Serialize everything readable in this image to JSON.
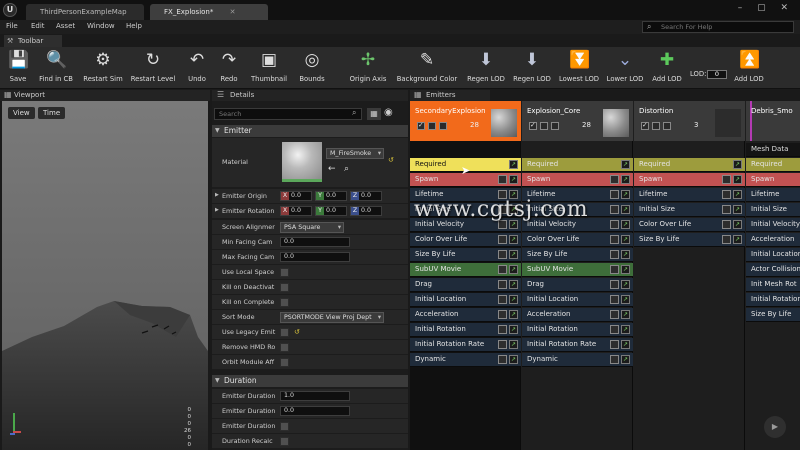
{
  "window": {
    "logo": "U",
    "tabs": [
      {
        "label": "ThirdPersonExampleMap"
      },
      {
        "label": "FX_Explosion*"
      }
    ],
    "controls_icons": [
      "minimize-icon",
      "maximize-icon",
      "close-icon"
    ],
    "controls_glyphs": "– ▢ ✕"
  },
  "menu": {
    "items": [
      "File",
      "Edit",
      "Asset",
      "Window",
      "Help"
    ],
    "search_placeholder": "Search For Help"
  },
  "toolbar": {
    "tab_label": "Toolbar",
    "buttons": [
      {
        "label": "Save",
        "icon": "save-icon",
        "glyph": "💾"
      },
      {
        "label": "Find in CB",
        "icon": "find-in-cb-icon",
        "glyph": "🔍"
      },
      {
        "label": "Restart Sim",
        "icon": "restart-sim-icon",
        "glyph": "⚙"
      },
      {
        "label": "Restart Level",
        "icon": "restart-level-icon",
        "glyph": "↻"
      },
      {
        "label": "Undo",
        "icon": "undo-icon",
        "glyph": "↶"
      },
      {
        "label": "Redo",
        "icon": "redo-icon",
        "glyph": "↷"
      },
      {
        "label": "Thumbnail",
        "icon": "thumbnail-icon",
        "glyph": "▣"
      },
      {
        "label": "Bounds",
        "icon": "bounds-icon",
        "glyph": "◎"
      },
      {
        "label": "Origin Axis",
        "icon": "origin-axis-icon",
        "glyph": "✢"
      },
      {
        "label": "Background Color",
        "icon": "background-color-icon",
        "glyph": "✎"
      },
      {
        "label": "Regen LOD",
        "icon": "regen-lod-icon",
        "glyph": "⬇"
      },
      {
        "label": "Regen LOD",
        "icon": "regen-lod-2-icon",
        "glyph": "⬇"
      },
      {
        "label": "Lowest LOD",
        "icon": "lowest-lod-icon",
        "glyph": "⏬"
      },
      {
        "label": "Lower LOD",
        "icon": "lower-lod-icon",
        "glyph": "⌄"
      },
      {
        "label": "Add LOD",
        "icon": "add-lod-icon",
        "glyph": "✚"
      },
      {
        "label": "Add LOD",
        "icon": "add-lod-2-icon",
        "glyph": "⏫"
      }
    ],
    "lod_label": "LOD:",
    "lod_value": "0"
  },
  "viewport": {
    "tab_label": "Viewport",
    "view_button": "View",
    "time_button": "Time",
    "axis_labels": [
      "0",
      "0",
      "0",
      "26",
      "0",
      "0"
    ]
  },
  "details": {
    "tab_label": "Details",
    "search_placeholder": "Search",
    "emitter_section": "Emitter",
    "material_label": "Material",
    "material_value": "M_FireSmoke",
    "origin_label": "Emitter Origin",
    "origin": {
      "x": "0.0",
      "y": "0.0",
      "z": "0.0"
    },
    "rotation_label": "Emitter Rotation",
    "rotation": {
      "x": "0.0",
      "y": "0.0",
      "z": "0.0"
    },
    "props": [
      {
        "label": "Screen Alignmer",
        "type": "combo",
        "value": "PSA Square"
      },
      {
        "label": "Min Facing Cam",
        "type": "num",
        "value": "0.0"
      },
      {
        "label": "Max Facing Cam",
        "type": "num",
        "value": "0.0"
      },
      {
        "label": "Use Local Space",
        "type": "check"
      },
      {
        "label": "Kill on Deactivat",
        "type": "check"
      },
      {
        "label": "Kill on Complete",
        "type": "check"
      },
      {
        "label": "Sort Mode",
        "type": "combo",
        "value": "PSORTMODE View Proj Dept"
      },
      {
        "label": "Use Legacy Emit",
        "type": "check"
      },
      {
        "label": "Remove HMD Ro",
        "type": "check"
      },
      {
        "label": "Orbit Module Aff",
        "type": "check"
      }
    ],
    "duration_section": "Duration",
    "duration_props": [
      {
        "label": "Emitter Duration",
        "type": "num",
        "value": "1.0"
      },
      {
        "label": "Emitter Duration",
        "type": "num",
        "value": "0.0"
      },
      {
        "label": "Emitter Duration",
        "type": "check"
      },
      {
        "label": "Duration Recalc",
        "type": "check"
      }
    ]
  },
  "emitters": {
    "tab_label": "Emitters",
    "columns": [
      {
        "name": "SecondaryExplosion",
        "count": "28",
        "header_color": "#f26a1b",
        "modules": [
          "Required",
          "Spawn",
          "Lifetime",
          "Initial Size",
          "Initial Velocity",
          "Color Over Life",
          "Size By Life",
          "SubUV Movie",
          "Drag",
          "Initial Location",
          "Acceleration",
          "Initial Rotation",
          "Initial Rotation Rate",
          "Dynamic"
        ]
      },
      {
        "name": "Explosion_Core",
        "count": "28",
        "header_color": "#3a3a3a",
        "modules": [
          "Required",
          "Spawn",
          "Lifetime",
          "Initial Size",
          "Initial Velocity",
          "Color Over Life",
          "Size By Life",
          "SubUV Movie",
          "Drag",
          "Initial Location",
          "Acceleration",
          "Initial Rotation",
          "Initial Rotation Rate",
          "Dynamic"
        ]
      },
      {
        "name": "Distortion",
        "count": "3",
        "header_color": "#3a3a3a",
        "modules": [
          "Required",
          "Spawn",
          "Lifetime",
          "Initial Size",
          "Color Over Life",
          "Size By Life"
        ]
      },
      {
        "name": "Debris_Smo",
        "count": "",
        "header_color": "#3a3a3a",
        "modules": [
          "Mesh Data",
          "Required",
          "Spawn",
          "Lifetime",
          "Initial Size",
          "Initial Velocity",
          "Acceleration",
          "Initial Location",
          "Actor Collision",
          "Init Mesh Rot",
          "Initial Rotation",
          "Size By Life"
        ]
      }
    ]
  },
  "watermark": "www.cgtsj.com",
  "colors": {
    "accent_selected": "#f26a1b",
    "required_selected": "#efe05a",
    "required": "#9d9c3d",
    "spawn": "#c25252",
    "subuv": "#3e6e3a",
    "module": "#1f2b3a"
  }
}
